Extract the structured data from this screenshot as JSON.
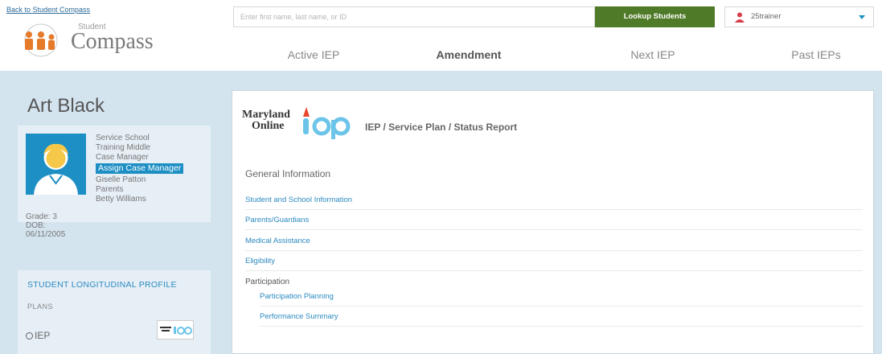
{
  "header": {
    "back_link": "Back to Student Compass",
    "logo_small": "Student",
    "logo_big": "Compass",
    "search_placeholder": "Enter first name, last name, or ID",
    "lookup_button": "Lookup Students",
    "user_name": "25trainer"
  },
  "tabs": [
    {
      "label": "Active IEP"
    },
    {
      "label": "Amendment"
    },
    {
      "label": "Next IEP"
    },
    {
      "label": "Past IEPs"
    }
  ],
  "student": {
    "name": "Art Black",
    "service_school_label": "Service School",
    "service_school": "Training Middle",
    "case_manager_label": "Case Manager",
    "assign_button": "Assign Case Manager",
    "case_manager": "Giselle Patton",
    "parents_label": "Parents",
    "parents": "Betty Williams",
    "grade": "Grade: 3",
    "dob_label": "DOB:",
    "dob": "06/11/2005"
  },
  "sidebar": {
    "profile_link": "STUDENT LONGITUDINAL PROFILE",
    "plans_label": "PLANS",
    "iep_label": "IEP"
  },
  "panel": {
    "logo_line1": "Maryland",
    "logo_line2": "Online",
    "logo_iep": "iep",
    "title": "IEP / Service Plan / Status Report",
    "section_heading": "General Information",
    "links": [
      "Student and School Information",
      "Parents/Guardians",
      "Medical Assistance",
      "Eligibility"
    ],
    "participation_heading": "Participation",
    "sub_links": [
      "Participation Planning",
      "Performance Summary"
    ]
  },
  "colors": {
    "accent_blue": "#1d8fc4",
    "lookup_green": "#4f7a28",
    "band_blue": "#d4e4ef"
  }
}
